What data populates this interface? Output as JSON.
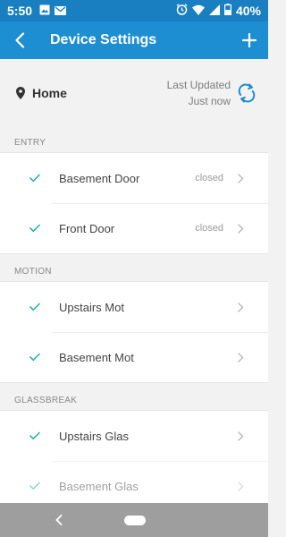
{
  "status_bar": {
    "time": "5:50",
    "battery": "40%",
    "icons": [
      "image-icon",
      "gmail-icon",
      "alarm-icon",
      "wifi-icon",
      "signal-icon",
      "battery-icon"
    ]
  },
  "app_bar": {
    "title": "Device Settings",
    "back_icon": "chevron-left-icon",
    "add_icon": "plus-icon"
  },
  "location": {
    "name": "Home",
    "last_updated_label": "Last Updated",
    "last_updated_value": "Just now",
    "refresh_icon": "refresh-icon"
  },
  "sections": [
    {
      "header": "ENTRY",
      "devices": [
        {
          "name": "Basement Door",
          "status": "closed"
        },
        {
          "name": "Front Door",
          "status": "closed"
        }
      ]
    },
    {
      "header": "MOTION",
      "devices": [
        {
          "name": "Upstairs Mot",
          "status": ""
        },
        {
          "name": "Basement Mot",
          "status": ""
        }
      ]
    },
    {
      "header": "GLASSBREAK",
      "devices": [
        {
          "name": "Upstairs Glas",
          "status": ""
        },
        {
          "name": "Basement Glas",
          "status": ""
        }
      ]
    }
  ],
  "colors": {
    "status_bar": "#1a7fc1",
    "app_bar": "#1d8ed2",
    "check": "#2bb3a8",
    "nav_bar": "#9e9e9e"
  }
}
